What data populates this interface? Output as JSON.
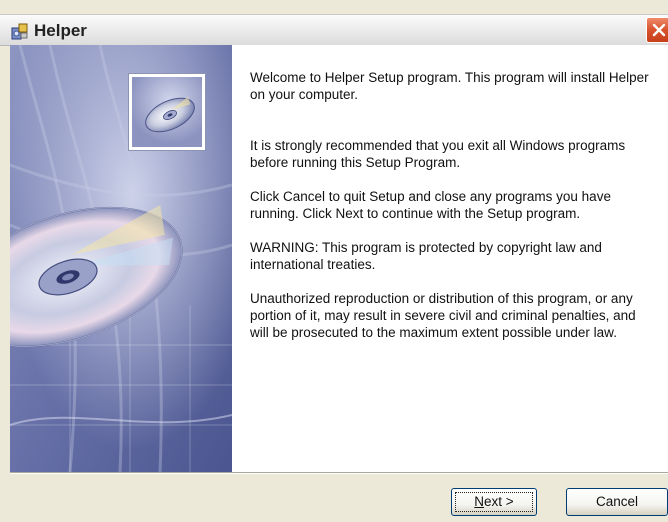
{
  "window": {
    "title": "Helper",
    "icon": "setup-installer-icon",
    "close_icon": "close-icon"
  },
  "side_image": {
    "description_icon": "cd-disc-icon"
  },
  "text": {
    "welcome": "Welcome to Helper Setup program. This program will install Helper on your computer.",
    "recommend": "It is strongly recommended that you exit all Windows programs before running this Setup Program.",
    "cancel_next": "Click Cancel to quit Setup and close any programs you have running.  Click Next to continue with the Setup program.",
    "warning": "WARNING: This program is protected by copyright law and international treaties.",
    "unauthorized": "Unauthorized reproduction or distribution of this program, or any portion of it, may result in severe civil and criminal penalties, and will be prosecuted to the maximum extent possible under law."
  },
  "buttons": {
    "next_mnemonic": "N",
    "next_rest": "ext >",
    "cancel": "Cancel"
  },
  "colors": {
    "title_accent": "#d8522c",
    "image_blue": "#5d6aa5",
    "button_border": "#003c74"
  }
}
